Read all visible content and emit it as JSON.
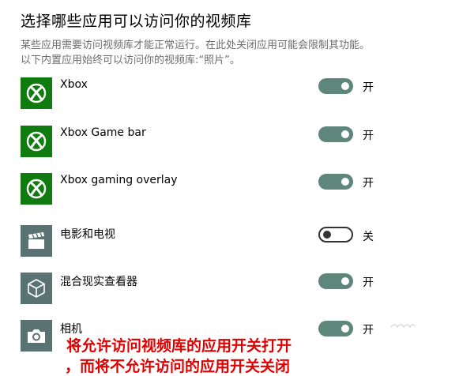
{
  "header": {
    "title": "选择哪些应用可以访问你的视频库",
    "description": "某些应用需要访问视频库才能正常运行。在此处关闭应用可能会限制其功能。以下内置应用始终可以访问你的视频库:“照片”。"
  },
  "apps": [
    {
      "name": "Xbox",
      "icon": "xbox-icon",
      "toggle": "on",
      "state_label": "开"
    },
    {
      "name": "Xbox Game bar",
      "icon": "xbox-icon",
      "toggle": "on",
      "state_label": "开"
    },
    {
      "name": "Xbox gaming overlay",
      "icon": "xbox-icon",
      "toggle": "on",
      "state_label": "开"
    },
    {
      "name": "电影和电视",
      "icon": "clapperboard-icon",
      "toggle": "off",
      "state_label": "关"
    },
    {
      "name": "混合现实查看器",
      "icon": "cube-icon",
      "toggle": "on",
      "state_label": "开"
    },
    {
      "name": "相机",
      "icon": "camera-icon",
      "toggle": "on",
      "state_label": "开"
    }
  ],
  "annotation": {
    "line1": "将允许访问视频库的应用开关打开",
    "line2": "，而将不允许访问的应用开关关闭"
  },
  "colors": {
    "xbox_tile": "#107c10",
    "app_tile": "#5b7272",
    "toggle_on": "#5f867a",
    "annotation": "#e00000"
  }
}
